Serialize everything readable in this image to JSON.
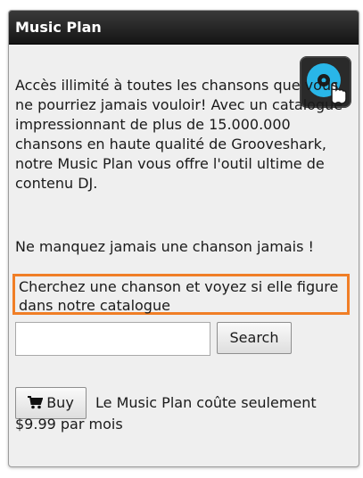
{
  "widget": {
    "title": "Music Plan",
    "icon": "dj-turntable-icon",
    "description": "Accès illimité à toutes les chansons que vous ne pourriez jamais vouloir!  Avec un catalogue impressionnant de plus de 15.000.000 chansons en haute qualité de Grooveshark, notre Music Plan vous offre l'outil ultime de contenu DJ.",
    "tagline": "Ne manquez jamais une chanson jamais !",
    "search_prompt": "Cherchez une chanson et voyez si elle figure dans notre catalogue",
    "search": {
      "value": "",
      "placeholder": "",
      "button_label": "Search"
    },
    "buy": {
      "icon": "shopping-cart-icon",
      "label": "Buy"
    },
    "price_text": "Le Music Plan coûte seulement $9.99 par mois"
  },
  "colors": {
    "header_bg": "#222222",
    "panel_bg": "#efefef",
    "highlight_border": "#f07e26",
    "icon_accent": "#29b6e8"
  }
}
